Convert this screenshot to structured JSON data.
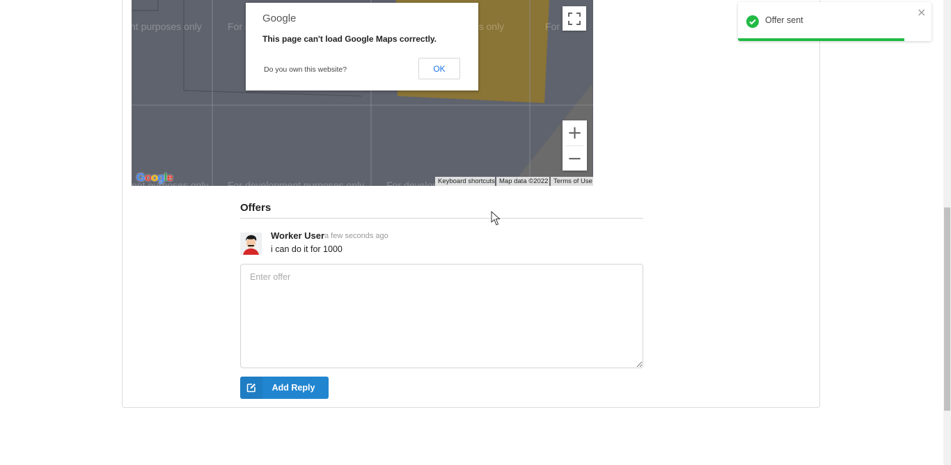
{
  "map": {
    "watermark": "For development purposes only",
    "dialog": {
      "brand": "Google",
      "message": "This page can't load Google Maps correctly.",
      "own_site": "Do you own this website?",
      "ok": "OK"
    },
    "controls": {
      "fullscreen_icon": "fullscreen-icon",
      "zoom_in": "+",
      "zoom_out": "−"
    },
    "logo": "Google",
    "attribution": {
      "keyboard": "Keyboard shortcuts",
      "map_data": "Map data ©2022",
      "terms": "Terms of Use"
    }
  },
  "offers": {
    "title": "Offers",
    "comments": [
      {
        "author": "Worker User",
        "time": "a few seconds ago",
        "text": "i can do it for 1000",
        "avatar": "avatar-illustration"
      }
    ],
    "input": {
      "placeholder": "Enter offer",
      "value": ""
    },
    "add_reply": {
      "label": "Add Reply",
      "icon": "edit-icon"
    }
  },
  "toast": {
    "text": "Offer sent",
    "icon": "check-circle-icon",
    "close": "×",
    "progress": 0.86,
    "color": "#21ba45"
  },
  "colors": {
    "primary": "#2185d0",
    "map_bg": "#5f636d",
    "map_highlight": "#8a7436"
  }
}
